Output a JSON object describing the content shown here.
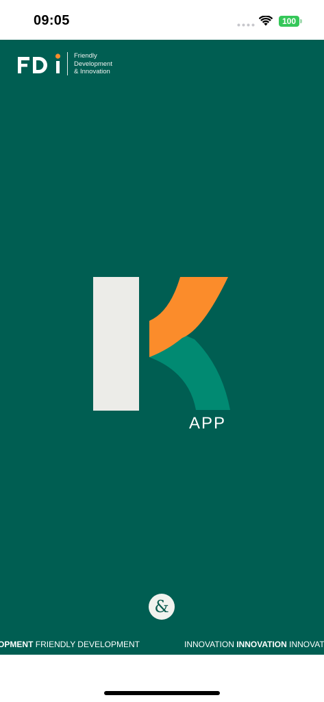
{
  "status_bar": {
    "time": "09:05",
    "battery_level": "100",
    "icons": [
      "signal-dots-icon",
      "wifi-icon",
      "battery-icon"
    ]
  },
  "brand": {
    "logo_text": "FDi",
    "tagline": [
      "Friendly",
      "Development",
      "& Innovation"
    ],
    "colors": {
      "background": "#005e52",
      "orange": "#fb8c2b",
      "teal": "#018a72",
      "light": "#ecece8"
    }
  },
  "splash": {
    "app_label": "APP"
  },
  "marquee": {
    "left_bold": "EVELOPMENT",
    "left_regular": " FRIENDLY DEVELOPMENT",
    "ampersand": "&",
    "right_regular_1": "INNOVATION ",
    "right_bold": "INNOVATION",
    "right_regular_2": " INNOVATIO"
  }
}
